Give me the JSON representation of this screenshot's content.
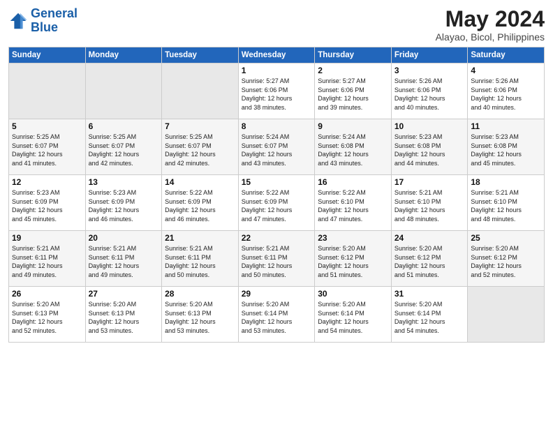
{
  "header": {
    "logo_line1": "General",
    "logo_line2": "Blue",
    "title": "May 2024",
    "subtitle": "Alayao, Bicol, Philippines"
  },
  "weekdays": [
    "Sunday",
    "Monday",
    "Tuesday",
    "Wednesday",
    "Thursday",
    "Friday",
    "Saturday"
  ],
  "weeks": [
    [
      {
        "day": "",
        "info": ""
      },
      {
        "day": "",
        "info": ""
      },
      {
        "day": "",
        "info": ""
      },
      {
        "day": "1",
        "info": "Sunrise: 5:27 AM\nSunset: 6:06 PM\nDaylight: 12 hours\nand 38 minutes."
      },
      {
        "day": "2",
        "info": "Sunrise: 5:27 AM\nSunset: 6:06 PM\nDaylight: 12 hours\nand 39 minutes."
      },
      {
        "day": "3",
        "info": "Sunrise: 5:26 AM\nSunset: 6:06 PM\nDaylight: 12 hours\nand 40 minutes."
      },
      {
        "day": "4",
        "info": "Sunrise: 5:26 AM\nSunset: 6:06 PM\nDaylight: 12 hours\nand 40 minutes."
      }
    ],
    [
      {
        "day": "5",
        "info": "Sunrise: 5:25 AM\nSunset: 6:07 PM\nDaylight: 12 hours\nand 41 minutes."
      },
      {
        "day": "6",
        "info": "Sunrise: 5:25 AM\nSunset: 6:07 PM\nDaylight: 12 hours\nand 42 minutes."
      },
      {
        "day": "7",
        "info": "Sunrise: 5:25 AM\nSunset: 6:07 PM\nDaylight: 12 hours\nand 42 minutes."
      },
      {
        "day": "8",
        "info": "Sunrise: 5:24 AM\nSunset: 6:07 PM\nDaylight: 12 hours\nand 43 minutes."
      },
      {
        "day": "9",
        "info": "Sunrise: 5:24 AM\nSunset: 6:08 PM\nDaylight: 12 hours\nand 43 minutes."
      },
      {
        "day": "10",
        "info": "Sunrise: 5:23 AM\nSunset: 6:08 PM\nDaylight: 12 hours\nand 44 minutes."
      },
      {
        "day": "11",
        "info": "Sunrise: 5:23 AM\nSunset: 6:08 PM\nDaylight: 12 hours\nand 45 minutes."
      }
    ],
    [
      {
        "day": "12",
        "info": "Sunrise: 5:23 AM\nSunset: 6:09 PM\nDaylight: 12 hours\nand 45 minutes."
      },
      {
        "day": "13",
        "info": "Sunrise: 5:23 AM\nSunset: 6:09 PM\nDaylight: 12 hours\nand 46 minutes."
      },
      {
        "day": "14",
        "info": "Sunrise: 5:22 AM\nSunset: 6:09 PM\nDaylight: 12 hours\nand 46 minutes."
      },
      {
        "day": "15",
        "info": "Sunrise: 5:22 AM\nSunset: 6:09 PM\nDaylight: 12 hours\nand 47 minutes."
      },
      {
        "day": "16",
        "info": "Sunrise: 5:22 AM\nSunset: 6:10 PM\nDaylight: 12 hours\nand 47 minutes."
      },
      {
        "day": "17",
        "info": "Sunrise: 5:21 AM\nSunset: 6:10 PM\nDaylight: 12 hours\nand 48 minutes."
      },
      {
        "day": "18",
        "info": "Sunrise: 5:21 AM\nSunset: 6:10 PM\nDaylight: 12 hours\nand 48 minutes."
      }
    ],
    [
      {
        "day": "19",
        "info": "Sunrise: 5:21 AM\nSunset: 6:11 PM\nDaylight: 12 hours\nand 49 minutes."
      },
      {
        "day": "20",
        "info": "Sunrise: 5:21 AM\nSunset: 6:11 PM\nDaylight: 12 hours\nand 49 minutes."
      },
      {
        "day": "21",
        "info": "Sunrise: 5:21 AM\nSunset: 6:11 PM\nDaylight: 12 hours\nand 50 minutes."
      },
      {
        "day": "22",
        "info": "Sunrise: 5:21 AM\nSunset: 6:11 PM\nDaylight: 12 hours\nand 50 minutes."
      },
      {
        "day": "23",
        "info": "Sunrise: 5:20 AM\nSunset: 6:12 PM\nDaylight: 12 hours\nand 51 minutes."
      },
      {
        "day": "24",
        "info": "Sunrise: 5:20 AM\nSunset: 6:12 PM\nDaylight: 12 hours\nand 51 minutes."
      },
      {
        "day": "25",
        "info": "Sunrise: 5:20 AM\nSunset: 6:12 PM\nDaylight: 12 hours\nand 52 minutes."
      }
    ],
    [
      {
        "day": "26",
        "info": "Sunrise: 5:20 AM\nSunset: 6:13 PM\nDaylight: 12 hours\nand 52 minutes."
      },
      {
        "day": "27",
        "info": "Sunrise: 5:20 AM\nSunset: 6:13 PM\nDaylight: 12 hours\nand 53 minutes."
      },
      {
        "day": "28",
        "info": "Sunrise: 5:20 AM\nSunset: 6:13 PM\nDaylight: 12 hours\nand 53 minutes."
      },
      {
        "day": "29",
        "info": "Sunrise: 5:20 AM\nSunset: 6:14 PM\nDaylight: 12 hours\nand 53 minutes."
      },
      {
        "day": "30",
        "info": "Sunrise: 5:20 AM\nSunset: 6:14 PM\nDaylight: 12 hours\nand 54 minutes."
      },
      {
        "day": "31",
        "info": "Sunrise: 5:20 AM\nSunset: 6:14 PM\nDaylight: 12 hours\nand 54 minutes."
      },
      {
        "day": "",
        "info": ""
      }
    ]
  ]
}
